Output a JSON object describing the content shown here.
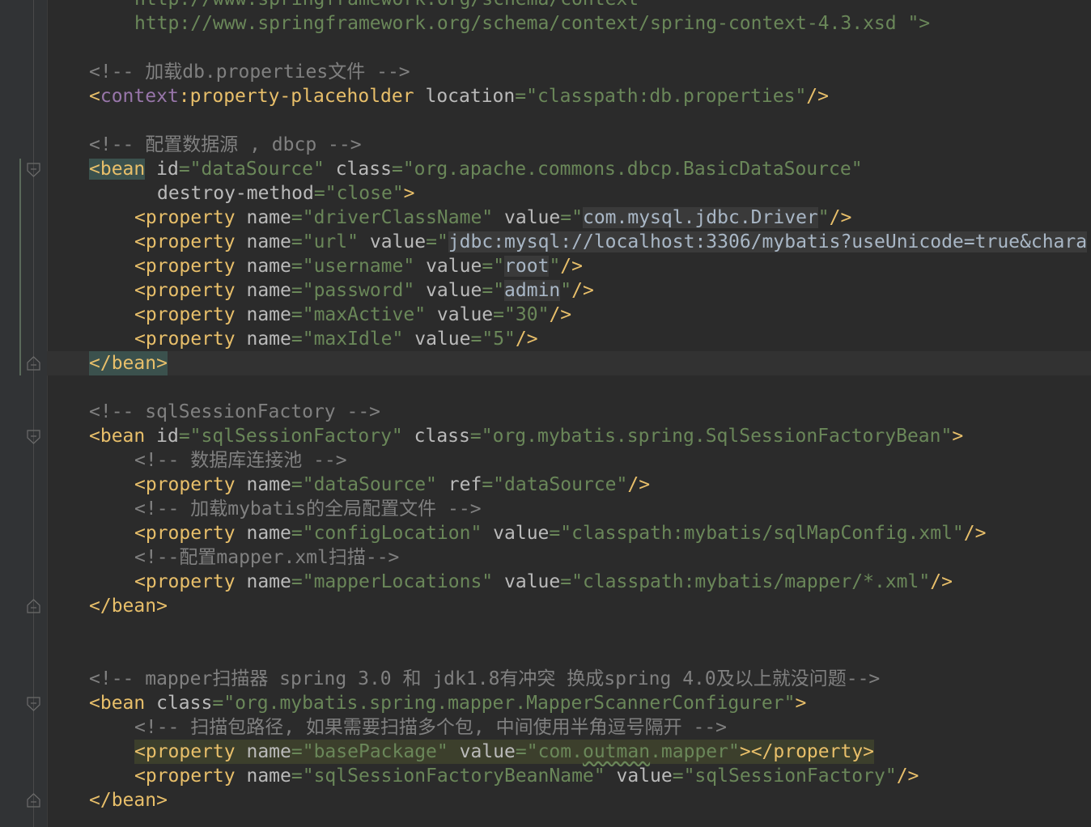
{
  "editor": {
    "lines": {
      "l0": "http://www.springframework.org/schema/context",
      "l1": "http://www.springframework.org/schema/context/spring-context-4.3.xsd \">",
      "l3": "<!-- 加载db.properties文件 -->",
      "l4": {
        "open": "<",
        "ns": "context",
        "colon": ":",
        "tag": "property-placeholder",
        "attr": "location",
        "eq": "=",
        "val": "\"classpath:db.properties\"",
        "close": "/>"
      },
      "l6": "<!-- 配置数据源 , dbcp -->",
      "l7": {
        "tag": "<bean",
        "a1": "id",
        "v1": "\"dataSource\"",
        "a2": "class",
        "v2": "\"org.apache.commons.dbcp.BasicDataSource\""
      },
      "l8": {
        "attr": "destroy-method",
        "val": "\"close\"",
        "close": ">"
      },
      "props1": [
        {
          "name": "\"driverClassName\"",
          "v_open": "\"",
          "v_inner": "com.mysql.jdbc.Driver",
          "v_close": "\""
        },
        {
          "name": "\"url\"",
          "v_open": "\"",
          "v_inner": "jdbc:mysql://localhost:3306/mybatis?useUnicode=true&chara",
          "v_close": ""
        },
        {
          "name": "\"username\"",
          "v_open": "\"",
          "v_inner": "root",
          "v_close": "\""
        },
        {
          "name": "\"password\"",
          "v_open": "\"",
          "v_inner": "admin",
          "v_close": "\""
        },
        {
          "name": "\"maxActive\"",
          "v_open": "\"",
          "v_inner": "30",
          "v_close": "\""
        },
        {
          "name": "\"maxIdle\"",
          "v_open": "\"",
          "v_inner": "5",
          "v_close": "\""
        }
      ],
      "l15": "</bean>",
      "l17": "<!-- sqlSessionFactory -->",
      "l18": {
        "tag": "<bean",
        "a1": "id",
        "v1": "\"sqlSessionFactory\"",
        "a2": "class",
        "v2": "\"org.mybatis.spring.SqlSessionFactoryBean\"",
        "close": ">"
      },
      "l19": "<!-- 数据库连接池 -->",
      "l20": {
        "tag": "<property",
        "a1": "name",
        "v1": "\"dataSource\"",
        "a2": "ref",
        "v2": "\"dataSource\"",
        "close": "/>"
      },
      "l21": "<!-- 加载mybatis的全局配置文件 -->",
      "l22": {
        "tag": "<property",
        "a1": "name",
        "v1": "\"configLocation\"",
        "a2": "value",
        "v2": "\"classpath:mybatis/sqlMapConfig.xml\"",
        "close": "/>"
      },
      "l23": "<!--配置mapper.xml扫描-->",
      "l24": {
        "tag": "<property",
        "a1": "name",
        "v1": "\"mapperLocations\"",
        "a2": "value",
        "v2": "\"classpath:mybatis/mapper/*.xml\"",
        "close": "/>"
      },
      "l25": "</bean>",
      "l28": "<!-- mapper扫描器 spring 3.0 和 jdk1.8有冲突 换成spring 4.0及以上就没问题-->",
      "l29": {
        "tag": "<bean",
        "a1": "class",
        "v1": "\"org.mybatis.spring.mapper.MapperScannerConfigurer\"",
        "close": ">"
      },
      "l30": "<!-- 扫描包路径, 如果需要扫描多个包, 中间使用半角逗号隔开 -->",
      "l31": {
        "tag": "<property",
        "a1": "name",
        "v1": "\"basePackage\"",
        "a2": "value",
        "v2a": "\"com.",
        "v2b": "outman",
        "v2c": ".mapper\"",
        "close": "></property>"
      },
      "l32": {
        "tag": "<property",
        "a1": "name",
        "v1": "\"sqlSessionFactoryBeanName\"",
        "a2": "value",
        "v2": "\"sqlSessionFactory\"",
        "close": "/>"
      },
      "l33": "</bean>"
    },
    "icons": [
      "fold-open-icon",
      "fold-close-icon"
    ],
    "colors": {
      "background": "#2b2b2b",
      "gutter": "#313335",
      "tag": "#e8bf6a",
      "namespace": "#9876aa",
      "attribute": "#bababa",
      "string": "#6a8759",
      "comment": "#808080"
    }
  }
}
